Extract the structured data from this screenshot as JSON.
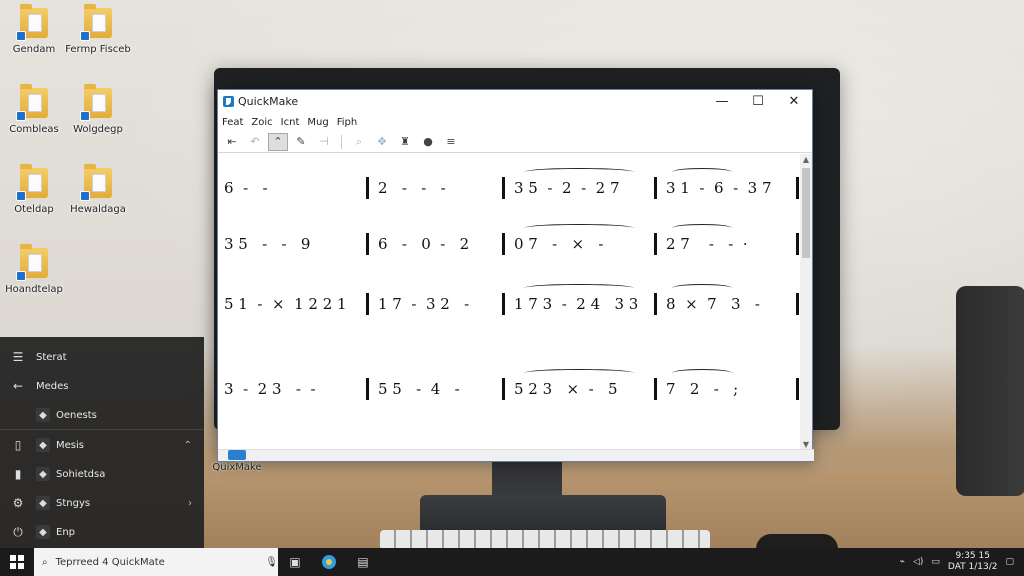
{
  "desktop": {
    "icons": [
      {
        "label": "Gendam",
        "icon": "folder-icon"
      },
      {
        "label": "Fermp Fisceb",
        "icon": "folder-icon"
      },
      {
        "label": "Combleas",
        "icon": "folder-icon"
      },
      {
        "label": "Wolgdegp",
        "icon": "folder-icon"
      },
      {
        "label": "Oteldap",
        "icon": "folder-icon"
      },
      {
        "label": "Hewaldaga",
        "icon": "folder-icon"
      },
      {
        "label": "Hoandtelap",
        "icon": "folder-icon"
      }
    ],
    "taskbar_label": "QuixMake"
  },
  "window": {
    "title": "QuickMake",
    "controls": {
      "minimize": "—",
      "maximize": "☐",
      "close": "✕"
    },
    "menu": [
      "Feat",
      "Zoic",
      "Icnt",
      "Mug",
      "Fiph"
    ],
    "toolbar": [
      {
        "icon": "arrow-left-icon",
        "glyph": "⇤",
        "state": "normal"
      },
      {
        "icon": "undo-icon",
        "glyph": "↶",
        "state": "dim"
      },
      {
        "icon": "select-icon",
        "glyph": "⌃",
        "state": "active"
      },
      {
        "icon": "draw-icon",
        "glyph": "✎",
        "state": "normal"
      },
      {
        "icon": "insert-icon",
        "glyph": "⊣",
        "state": "dim"
      },
      {
        "icon": "zoom-icon",
        "glyph": "⌕",
        "state": "dim"
      },
      {
        "icon": "move-icon",
        "glyph": "✥",
        "state": "dim"
      },
      {
        "icon": "stamp-icon",
        "glyph": "♜",
        "state": "normal"
      },
      {
        "icon": "record-icon",
        "glyph": "●",
        "state": "normal"
      },
      {
        "icon": "list-icon",
        "glyph": "≡",
        "state": "normal"
      }
    ],
    "score": {
      "rows": [
        {
          "measures": [
            "6  -   -",
            "2   -   -   -",
            "3 5  -  2  -  2 7",
            "3 1  -  6  -  3 7"
          ]
        },
        {
          "measures": [
            "3 5   -   -   9",
            "6   -   0  -   2",
            "0 7   -   ×   -",
            "2 7    -   -  ·"
          ]
        },
        {
          "measures": [
            "5 1  -  ×  1 2 2 1",
            "1 7  -  3 2   -",
            "1 7 3  -  2 4   3 3",
            "8  ×  7   3   -"
          ]
        },
        {
          "measures": [
            "3  -  2 3   -  -",
            "5 5   -  4   -",
            "5 2 3   ×  -   5",
            "7   2   -   ;"
          ]
        }
      ]
    }
  },
  "start_menu": {
    "items": [
      {
        "glyph": "☰",
        "label": "Sterat",
        "icon": "hamburger-icon"
      },
      {
        "glyph": "←",
        "label": "Medes",
        "icon": "back-icon"
      },
      {
        "glyph": "",
        "label": "Oenests",
        "icon": "app-icon"
      },
      {
        "glyph": "▯",
        "label": "Mesis",
        "icon": "music-icon",
        "chevron": "⌃"
      },
      {
        "glyph": "▮",
        "label": "Sohietdsa",
        "icon": "photos-icon"
      },
      {
        "glyph": "⚙",
        "label": "Stngys",
        "icon": "settings-icon",
        "chevron": "›"
      },
      {
        "glyph": "⏻",
        "label": "Enp",
        "icon": "power-icon"
      }
    ]
  },
  "taskbar": {
    "search_placeholder": "Teprreed 4 QuickMate",
    "clock_time": "9:35 15",
    "clock_date": "DAT 1/13/2",
    "apps": [
      "file-explorer-icon",
      "edge-icon",
      "quickmake-icon"
    ]
  }
}
